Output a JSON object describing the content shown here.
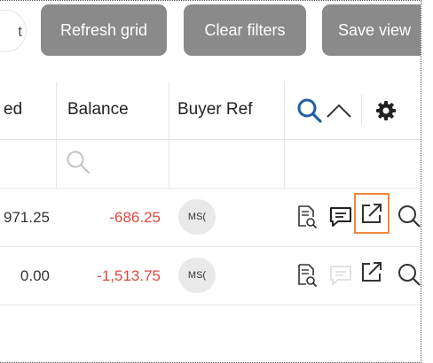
{
  "toolbar": {
    "partial_pill_label": "t",
    "refresh_label": "Refresh grid",
    "clear_label": "Clear filters",
    "save_label": "Save view"
  },
  "grid": {
    "columns": {
      "partial_label": "ed",
      "balance_label": "Balance",
      "buyer_ref_label": "Buyer Ref"
    },
    "rows": [
      {
        "partial_amount": "971.25",
        "balance": "-686.25",
        "buyer_ref": "MS("
      },
      {
        "partial_amount": "0.00",
        "balance": "-1,513.75",
        "buyer_ref": "MS("
      }
    ]
  },
  "colors": {
    "button_gray": "#8a8a8a",
    "negative_red": "#e0463f",
    "icon_blue": "#1f5fa9",
    "highlight_orange": "#f0883a"
  },
  "icons": [
    "search-icon",
    "chevron-up-icon",
    "gear-icon",
    "filter-search-icon",
    "document-search-icon",
    "comment-icon",
    "open-external-icon"
  ]
}
